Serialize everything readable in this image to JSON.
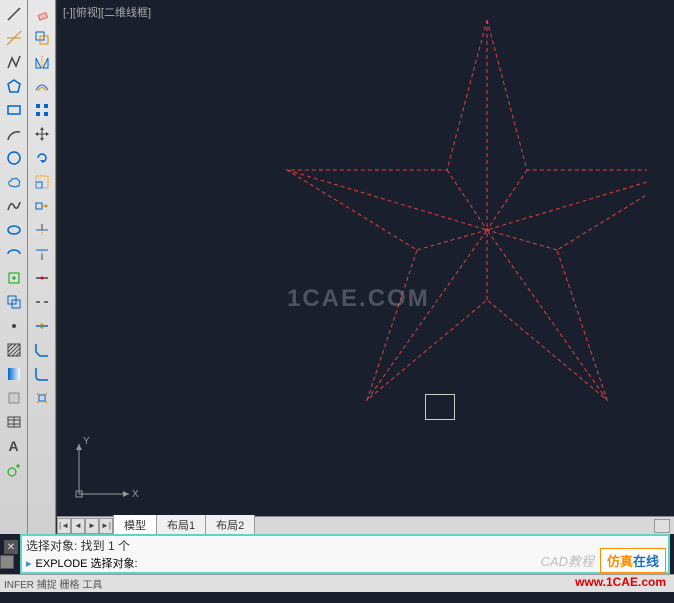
{
  "viewport": {
    "label": "[-][俯视][二维线框]"
  },
  "watermark": {
    "center": "1CAE.COM",
    "right_text1": "CAD教程",
    "box1": "仿真",
    "box2": "在线",
    "url": "www.1CAE.com"
  },
  "tabs": {
    "nav_first": "|◄",
    "nav_prev": "◄",
    "nav_next": "►",
    "nav_last": "►|",
    "items": [
      {
        "label": "模型",
        "active": true
      },
      {
        "label": "布局1",
        "active": false
      },
      {
        "label": "布局2",
        "active": false
      }
    ]
  },
  "command": {
    "line1": "选择对象: 找到 1 个",
    "prompt": "EXPLODE 选择对象:"
  },
  "ucs": {
    "x_label": "X",
    "y_label": "Y"
  },
  "close": "✕",
  "status": {
    "text": "INFER  捕捉  栅格  工具"
  },
  "toolbar_left": {
    "tools": [
      "line-icon",
      "construction-line-icon",
      "polyline-icon",
      "polygon-icon",
      "rectangle-icon",
      "arc-icon",
      "circle-icon",
      "revision-cloud-icon",
      "spline-icon",
      "ellipse-icon",
      "ellipse-arc-icon",
      "insert-block-icon",
      "make-block-icon",
      "point-icon",
      "hatch-icon",
      "gradient-icon",
      "region-icon",
      "table-icon",
      "multiline-text-icon",
      "add-selected-icon"
    ]
  },
  "toolbar_right": {
    "tools": [
      "erase-icon",
      "copy-icon",
      "mirror-icon",
      "offset-icon",
      "array-icon",
      "move-icon",
      "rotate-icon",
      "scale-icon",
      "stretch-icon",
      "trim-icon",
      "extend-icon",
      "break-at-point-icon",
      "break-icon",
      "join-icon",
      "chamfer-icon",
      "fillet-icon",
      "explode-icon"
    ]
  }
}
